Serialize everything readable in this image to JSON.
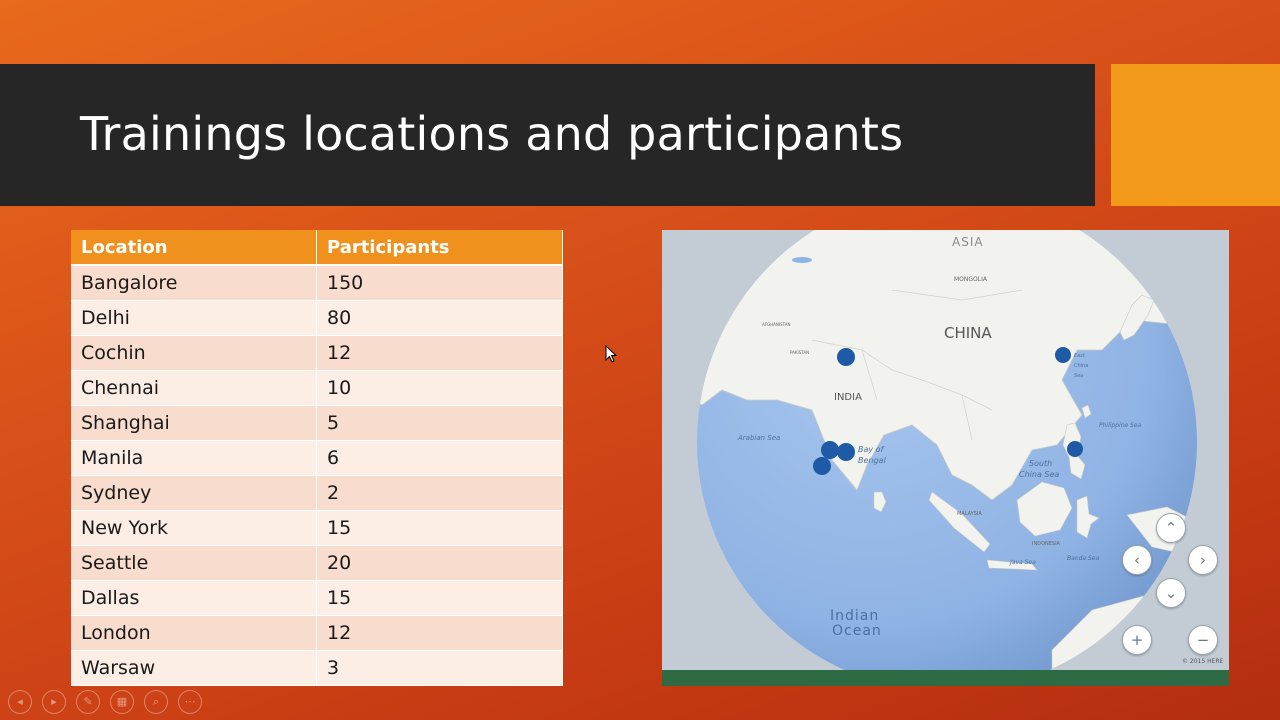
{
  "slide": {
    "title": "Trainings locations and participants"
  },
  "table": {
    "headers": [
      "Location",
      "Participants"
    ],
    "rows": [
      [
        "Bangalore",
        "150"
      ],
      [
        "Delhi",
        "80"
      ],
      [
        "Cochin",
        "12"
      ],
      [
        "Chennai",
        "10"
      ],
      [
        "Shanghai",
        "5"
      ],
      [
        "Manila",
        "6"
      ],
      [
        "Sydney",
        "2"
      ],
      [
        "New York",
        "15"
      ],
      [
        "Seattle",
        "20"
      ],
      [
        "Dallas",
        "15"
      ],
      [
        "London",
        "12"
      ],
      [
        "Warsaw",
        "3"
      ]
    ]
  },
  "map": {
    "labels": {
      "asia": "ASIA",
      "china": "CHINA",
      "mongolia": "MONGOLIA",
      "india": "INDIA",
      "arabian_sea": "Arabian Sea",
      "bay_of_bengal_1": "Bay of",
      "bay_of_bengal_2": "Bengal",
      "south_china_sea_1": "South",
      "south_china_sea_2": "China Sea",
      "east_china_sea_1": "East",
      "east_china_sea_2": "China",
      "east_china_sea_3": "Sea",
      "philippine_sea": "Philippine Sea",
      "indian_ocean_1": "Indian",
      "indian_ocean_2": "Ocean",
      "malaysia": "MALAYSIA",
      "indonesia": "INDONESIA",
      "java_sea": "Java Sea",
      "banda_sea": "Banda Sea",
      "afghanistan": "AFGHANISTAN",
      "pakistan": "PAKISTAN"
    },
    "copyright": "© 2015 HERE",
    "controls": {
      "up": "⌃",
      "left": "‹",
      "right": "›",
      "down": "⌄",
      "zoom_in": "+",
      "zoom_out": "−"
    },
    "marker_color": "#1f5aa6"
  },
  "slideshow_controls": [
    "◂",
    "▸",
    "✎",
    "▦",
    "⌕",
    "⋯"
  ],
  "colors": {
    "title_bar": "#262626",
    "accent": "#f39a1b",
    "table_header": "#f0901d",
    "ocean": "#8fb3e4",
    "land": "#f3f3f1"
  }
}
